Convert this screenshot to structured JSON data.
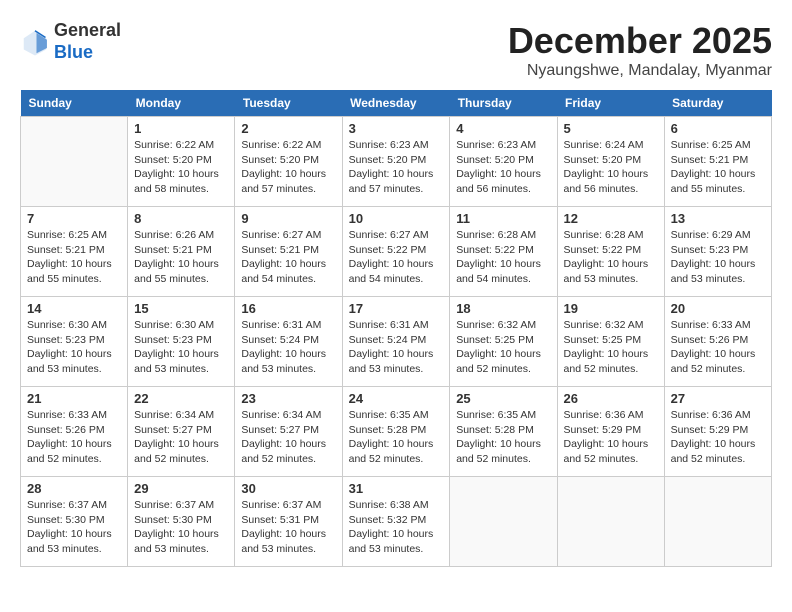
{
  "header": {
    "logo_general": "General",
    "logo_blue": "Blue",
    "month_title": "December 2025",
    "location": "Nyaungshwe, Mandalay, Myanmar"
  },
  "days_of_week": [
    "Sunday",
    "Monday",
    "Tuesday",
    "Wednesday",
    "Thursday",
    "Friday",
    "Saturday"
  ],
  "weeks": [
    [
      {
        "day": "",
        "info": ""
      },
      {
        "day": "1",
        "info": "Sunrise: 6:22 AM\nSunset: 5:20 PM\nDaylight: 10 hours\nand 58 minutes."
      },
      {
        "day": "2",
        "info": "Sunrise: 6:22 AM\nSunset: 5:20 PM\nDaylight: 10 hours\nand 57 minutes."
      },
      {
        "day": "3",
        "info": "Sunrise: 6:23 AM\nSunset: 5:20 PM\nDaylight: 10 hours\nand 57 minutes."
      },
      {
        "day": "4",
        "info": "Sunrise: 6:23 AM\nSunset: 5:20 PM\nDaylight: 10 hours\nand 56 minutes."
      },
      {
        "day": "5",
        "info": "Sunrise: 6:24 AM\nSunset: 5:20 PM\nDaylight: 10 hours\nand 56 minutes."
      },
      {
        "day": "6",
        "info": "Sunrise: 6:25 AM\nSunset: 5:21 PM\nDaylight: 10 hours\nand 55 minutes."
      }
    ],
    [
      {
        "day": "7",
        "info": "Sunrise: 6:25 AM\nSunset: 5:21 PM\nDaylight: 10 hours\nand 55 minutes."
      },
      {
        "day": "8",
        "info": "Sunrise: 6:26 AM\nSunset: 5:21 PM\nDaylight: 10 hours\nand 55 minutes."
      },
      {
        "day": "9",
        "info": "Sunrise: 6:27 AM\nSunset: 5:21 PM\nDaylight: 10 hours\nand 54 minutes."
      },
      {
        "day": "10",
        "info": "Sunrise: 6:27 AM\nSunset: 5:22 PM\nDaylight: 10 hours\nand 54 minutes."
      },
      {
        "day": "11",
        "info": "Sunrise: 6:28 AM\nSunset: 5:22 PM\nDaylight: 10 hours\nand 54 minutes."
      },
      {
        "day": "12",
        "info": "Sunrise: 6:28 AM\nSunset: 5:22 PM\nDaylight: 10 hours\nand 53 minutes."
      },
      {
        "day": "13",
        "info": "Sunrise: 6:29 AM\nSunset: 5:23 PM\nDaylight: 10 hours\nand 53 minutes."
      }
    ],
    [
      {
        "day": "14",
        "info": "Sunrise: 6:30 AM\nSunset: 5:23 PM\nDaylight: 10 hours\nand 53 minutes."
      },
      {
        "day": "15",
        "info": "Sunrise: 6:30 AM\nSunset: 5:23 PM\nDaylight: 10 hours\nand 53 minutes."
      },
      {
        "day": "16",
        "info": "Sunrise: 6:31 AM\nSunset: 5:24 PM\nDaylight: 10 hours\nand 53 minutes."
      },
      {
        "day": "17",
        "info": "Sunrise: 6:31 AM\nSunset: 5:24 PM\nDaylight: 10 hours\nand 53 minutes."
      },
      {
        "day": "18",
        "info": "Sunrise: 6:32 AM\nSunset: 5:25 PM\nDaylight: 10 hours\nand 52 minutes."
      },
      {
        "day": "19",
        "info": "Sunrise: 6:32 AM\nSunset: 5:25 PM\nDaylight: 10 hours\nand 52 minutes."
      },
      {
        "day": "20",
        "info": "Sunrise: 6:33 AM\nSunset: 5:26 PM\nDaylight: 10 hours\nand 52 minutes."
      }
    ],
    [
      {
        "day": "21",
        "info": "Sunrise: 6:33 AM\nSunset: 5:26 PM\nDaylight: 10 hours\nand 52 minutes."
      },
      {
        "day": "22",
        "info": "Sunrise: 6:34 AM\nSunset: 5:27 PM\nDaylight: 10 hours\nand 52 minutes."
      },
      {
        "day": "23",
        "info": "Sunrise: 6:34 AM\nSunset: 5:27 PM\nDaylight: 10 hours\nand 52 minutes."
      },
      {
        "day": "24",
        "info": "Sunrise: 6:35 AM\nSunset: 5:28 PM\nDaylight: 10 hours\nand 52 minutes."
      },
      {
        "day": "25",
        "info": "Sunrise: 6:35 AM\nSunset: 5:28 PM\nDaylight: 10 hours\nand 52 minutes."
      },
      {
        "day": "26",
        "info": "Sunrise: 6:36 AM\nSunset: 5:29 PM\nDaylight: 10 hours\nand 52 minutes."
      },
      {
        "day": "27",
        "info": "Sunrise: 6:36 AM\nSunset: 5:29 PM\nDaylight: 10 hours\nand 52 minutes."
      }
    ],
    [
      {
        "day": "28",
        "info": "Sunrise: 6:37 AM\nSunset: 5:30 PM\nDaylight: 10 hours\nand 53 minutes."
      },
      {
        "day": "29",
        "info": "Sunrise: 6:37 AM\nSunset: 5:30 PM\nDaylight: 10 hours\nand 53 minutes."
      },
      {
        "day": "30",
        "info": "Sunrise: 6:37 AM\nSunset: 5:31 PM\nDaylight: 10 hours\nand 53 minutes."
      },
      {
        "day": "31",
        "info": "Sunrise: 6:38 AM\nSunset: 5:32 PM\nDaylight: 10 hours\nand 53 minutes."
      },
      {
        "day": "",
        "info": ""
      },
      {
        "day": "",
        "info": ""
      },
      {
        "day": "",
        "info": ""
      }
    ]
  ]
}
